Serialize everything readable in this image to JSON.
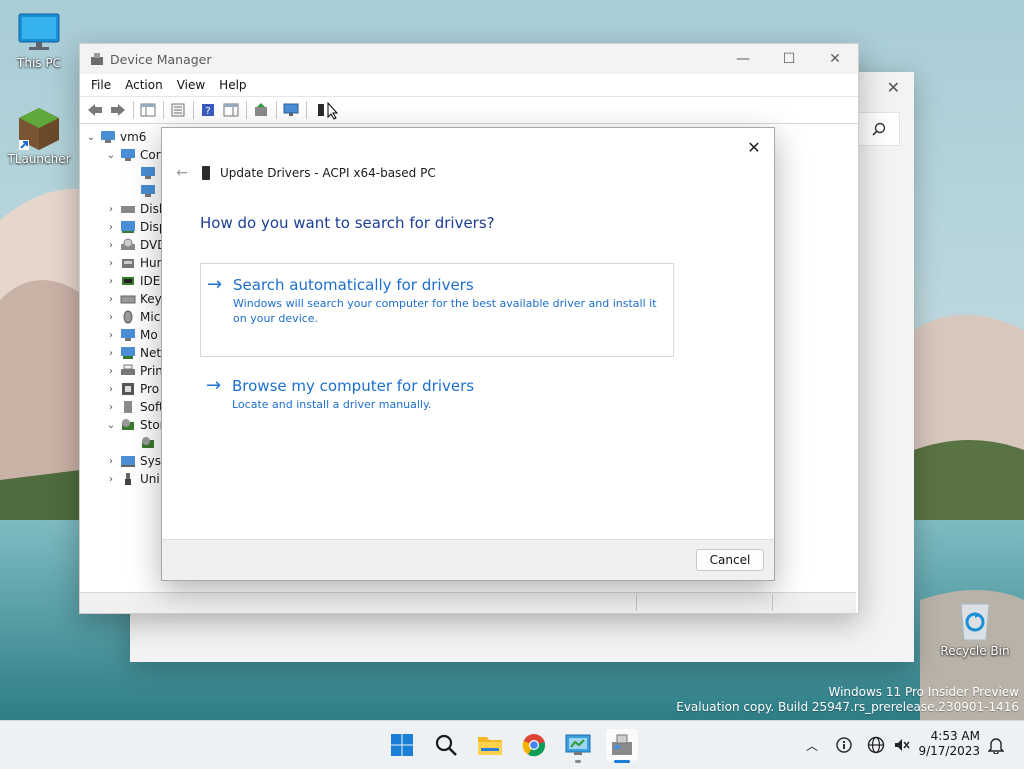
{
  "desktop": {
    "icons": [
      {
        "label": "This PC"
      },
      {
        "label": "TLauncher"
      },
      {
        "label": "Recycle Bin"
      }
    ]
  },
  "device_manager": {
    "title": "Device Manager",
    "menu": [
      "File",
      "Action",
      "View",
      "Help"
    ],
    "tree": {
      "root": "vm6",
      "rows": [
        "Cor",
        "Disk",
        "Disp",
        "DVD",
        "Hun",
        "IDE",
        "Key",
        "Mic",
        "Mo",
        "Net",
        "Prin",
        "Pro",
        "Soft",
        "Stor",
        "Syst",
        "Uni"
      ]
    }
  },
  "dialog": {
    "title": "Update Drivers - ACPI x64-based PC",
    "question": "How do you want to search for drivers?",
    "option_auto": {
      "title": "Search automatically for drivers",
      "description": "Windows will search your computer for the best available driver and install it on your device."
    },
    "option_browse": {
      "title": "Browse my computer for drivers",
      "description": "Locate and install a driver manually."
    },
    "cancel_label": "Cancel"
  },
  "watermark": {
    "line1": "Windows 11 Pro Insider Preview",
    "line2": "Evaluation copy. Build 25947.rs_prerelease.230901-1416"
  },
  "taskbar": {
    "time": "4:53 AM",
    "date": "9/17/2023"
  },
  "colors": {
    "accent": "#1c6fcc",
    "question": "#1c3f94"
  }
}
